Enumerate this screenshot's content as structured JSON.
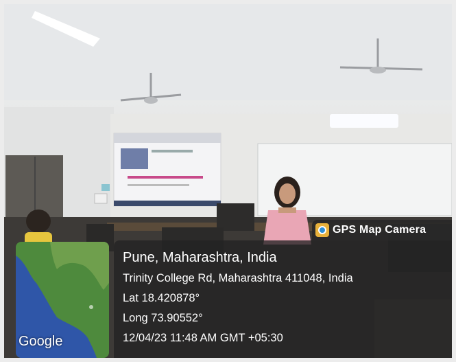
{
  "overlay": {
    "badge_label": "GPS Map Camera",
    "map_logo": "Google",
    "location": "Pune, Maharashtra, India",
    "address": "Trinity College Rd, Maharashtra 411048, India",
    "lat": "Lat 18.420878°",
    "long": "Long 73.90552°",
    "datetime": "12/04/23 11:48 AM GMT +05:30"
  },
  "colors": {
    "overlay_bg": "#222222",
    "badge_icon": "#e8b13b",
    "map_land": "#4e8a3d",
    "map_water": "#2f56a8"
  }
}
